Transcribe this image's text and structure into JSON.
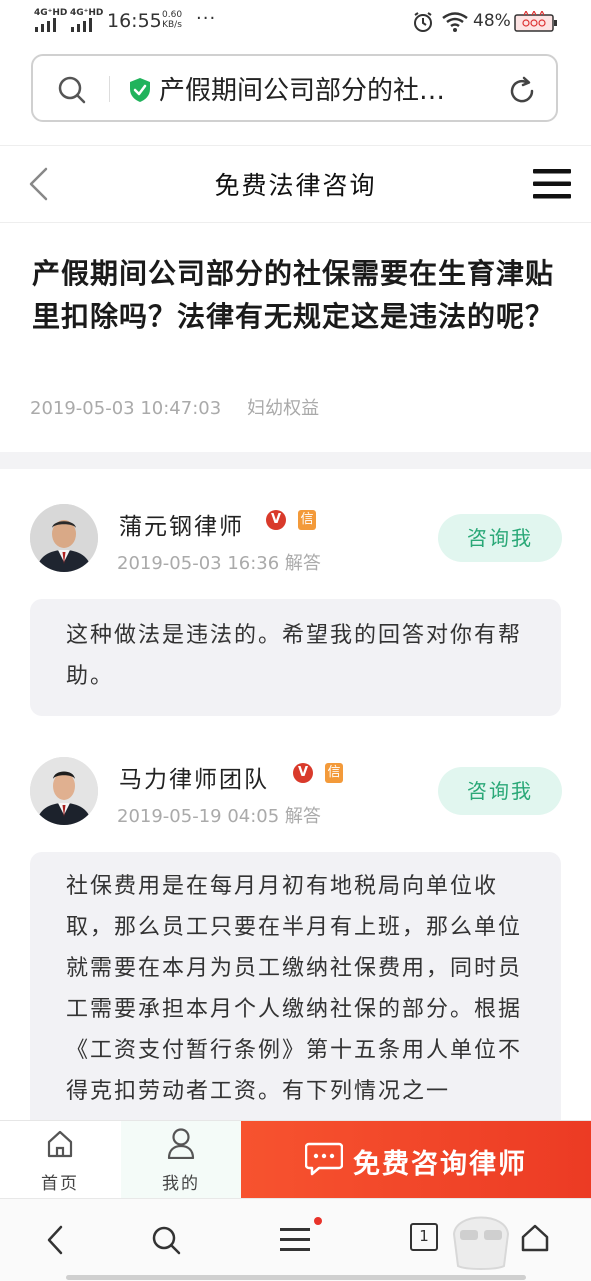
{
  "status_bar": {
    "net1": "4G⁺HD",
    "net2": "4G⁺HD",
    "time": "16:55",
    "speed_value": "0.60",
    "speed_unit": "KB/s",
    "dots": "···",
    "battery": "48%"
  },
  "url_bar": {
    "url_text": "产假期间公司部分的社…"
  },
  "header": {
    "title": "免费法律咨询"
  },
  "question": {
    "title": "产假期间公司部分的社保需要在生育津贴里扣除吗？法律有无规定这是违法的呢？",
    "date": "2019-05-03 10:47:03",
    "category": "妇幼权益"
  },
  "answers": [
    {
      "lawyer_name": "蒲元钢律师",
      "v_badge": "V",
      "xin_badge": "信",
      "meta": "2019-05-03 16:36 解答",
      "consult_label": "咨询我",
      "content": "这种做法是违法的。希望我的回答对你有帮助。"
    },
    {
      "lawyer_name": "马力律师团队",
      "v_badge": "V",
      "xin_badge": "信",
      "meta": "2019-05-19 04:05 解答",
      "consult_label": "咨询我",
      "content": "社保费用是在每月月初有地税局向单位收取，那么员工只要在半月有上班，那么单位就需要在本月为员工缴纳社保费用，同时员工需要承担本月个人缴纳社保的部分。根据《工资支付暂行条例》第十五条用人单位不得克扣劳动者工资。有下列情况之一"
    }
  ],
  "bottom_nav": {
    "home_label": "首页",
    "mine_label": "我的",
    "cta_label": "免费咨询律师"
  },
  "browser_bar": {
    "tab_count": "1"
  },
  "colors": {
    "accent_green": "#2aa877",
    "cta_red": "#ee4128",
    "v_badge_red": "#d93a2b",
    "xin_badge_orange": "#f39a3a",
    "shield_green": "#21b35c"
  }
}
